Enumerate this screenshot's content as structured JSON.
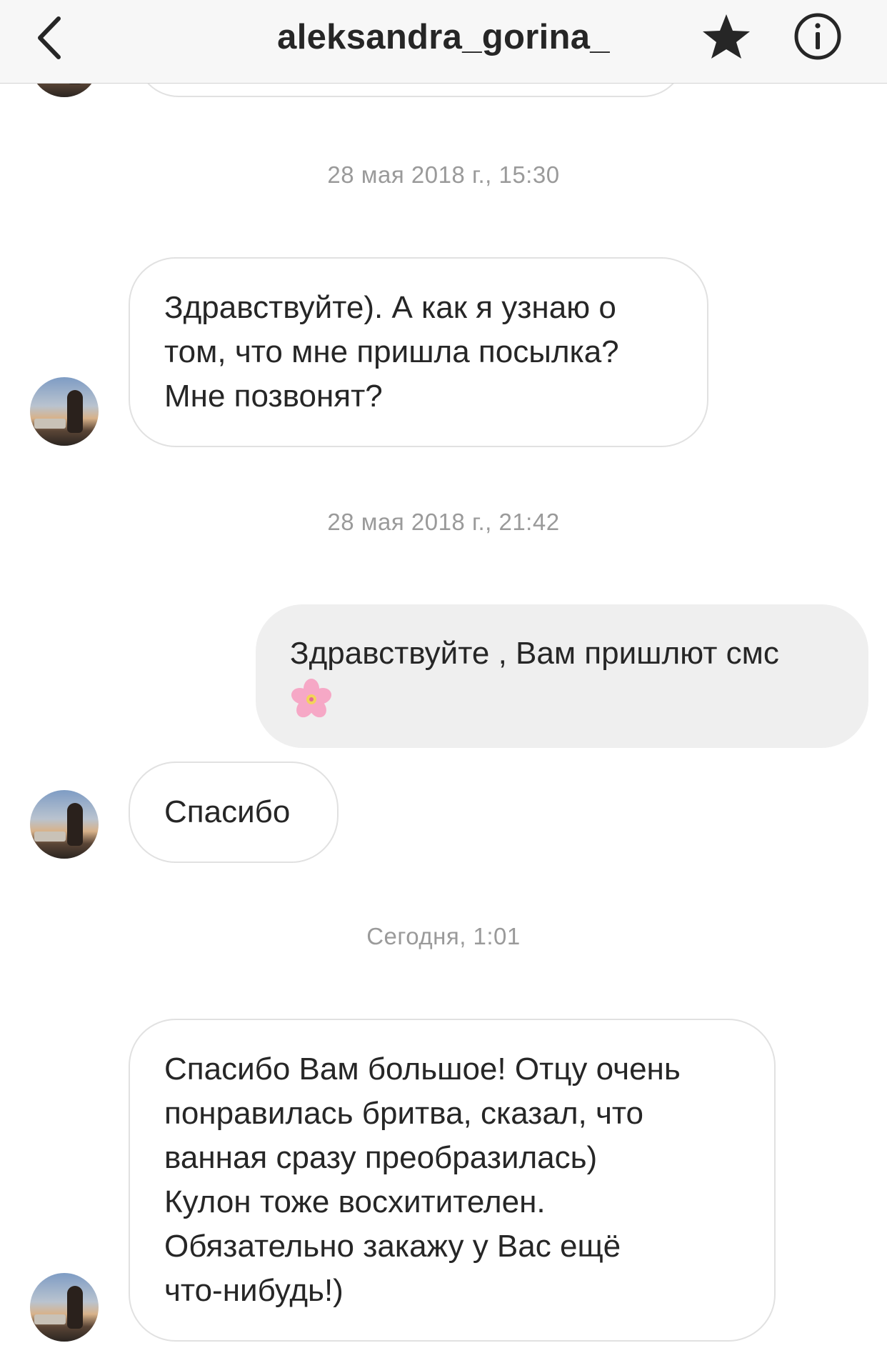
{
  "header": {
    "title": "aleksandra_gorina_",
    "back_icon": "chevron-left-icon",
    "star_icon": "star-icon",
    "info_icon": "info-icon"
  },
  "timestamps": [
    "28 мая 2018 г., 15:30",
    "28 мая 2018 г., 21:42",
    "Сегодня, 1:01"
  ],
  "messages": [
    {
      "from": "aleksandra_gorina_",
      "lines": [
        "Здравствуйте). А как я узнаю о",
        "том, что мне пришла посылка?",
        "Мне позвонят?"
      ]
    },
    {
      "from": "me",
      "lines": [
        "Здравствуйте , Вам пришлют смс"
      ],
      "emoji": "cherry-blossom-icon"
    },
    {
      "from": "aleksandra_gorina_",
      "lines": [
        "Спасибо"
      ]
    },
    {
      "from": "aleksandra_gorina_",
      "lines": [
        "Спасибо Вам большое! Отцу очень",
        "понравилась бритва, сказал, что",
        "ванная сразу преобразилась)",
        "Кулон тоже восхитителен.",
        "Обязательно закажу у Вас ещё",
        "что-нибудь!)"
      ]
    }
  ],
  "colors": {
    "header_bg": "#f7f7f7",
    "incoming_border": "#e1e1e1",
    "outgoing_bg": "#efefef",
    "timestamp": "#9a9a9a",
    "text": "#262626"
  }
}
